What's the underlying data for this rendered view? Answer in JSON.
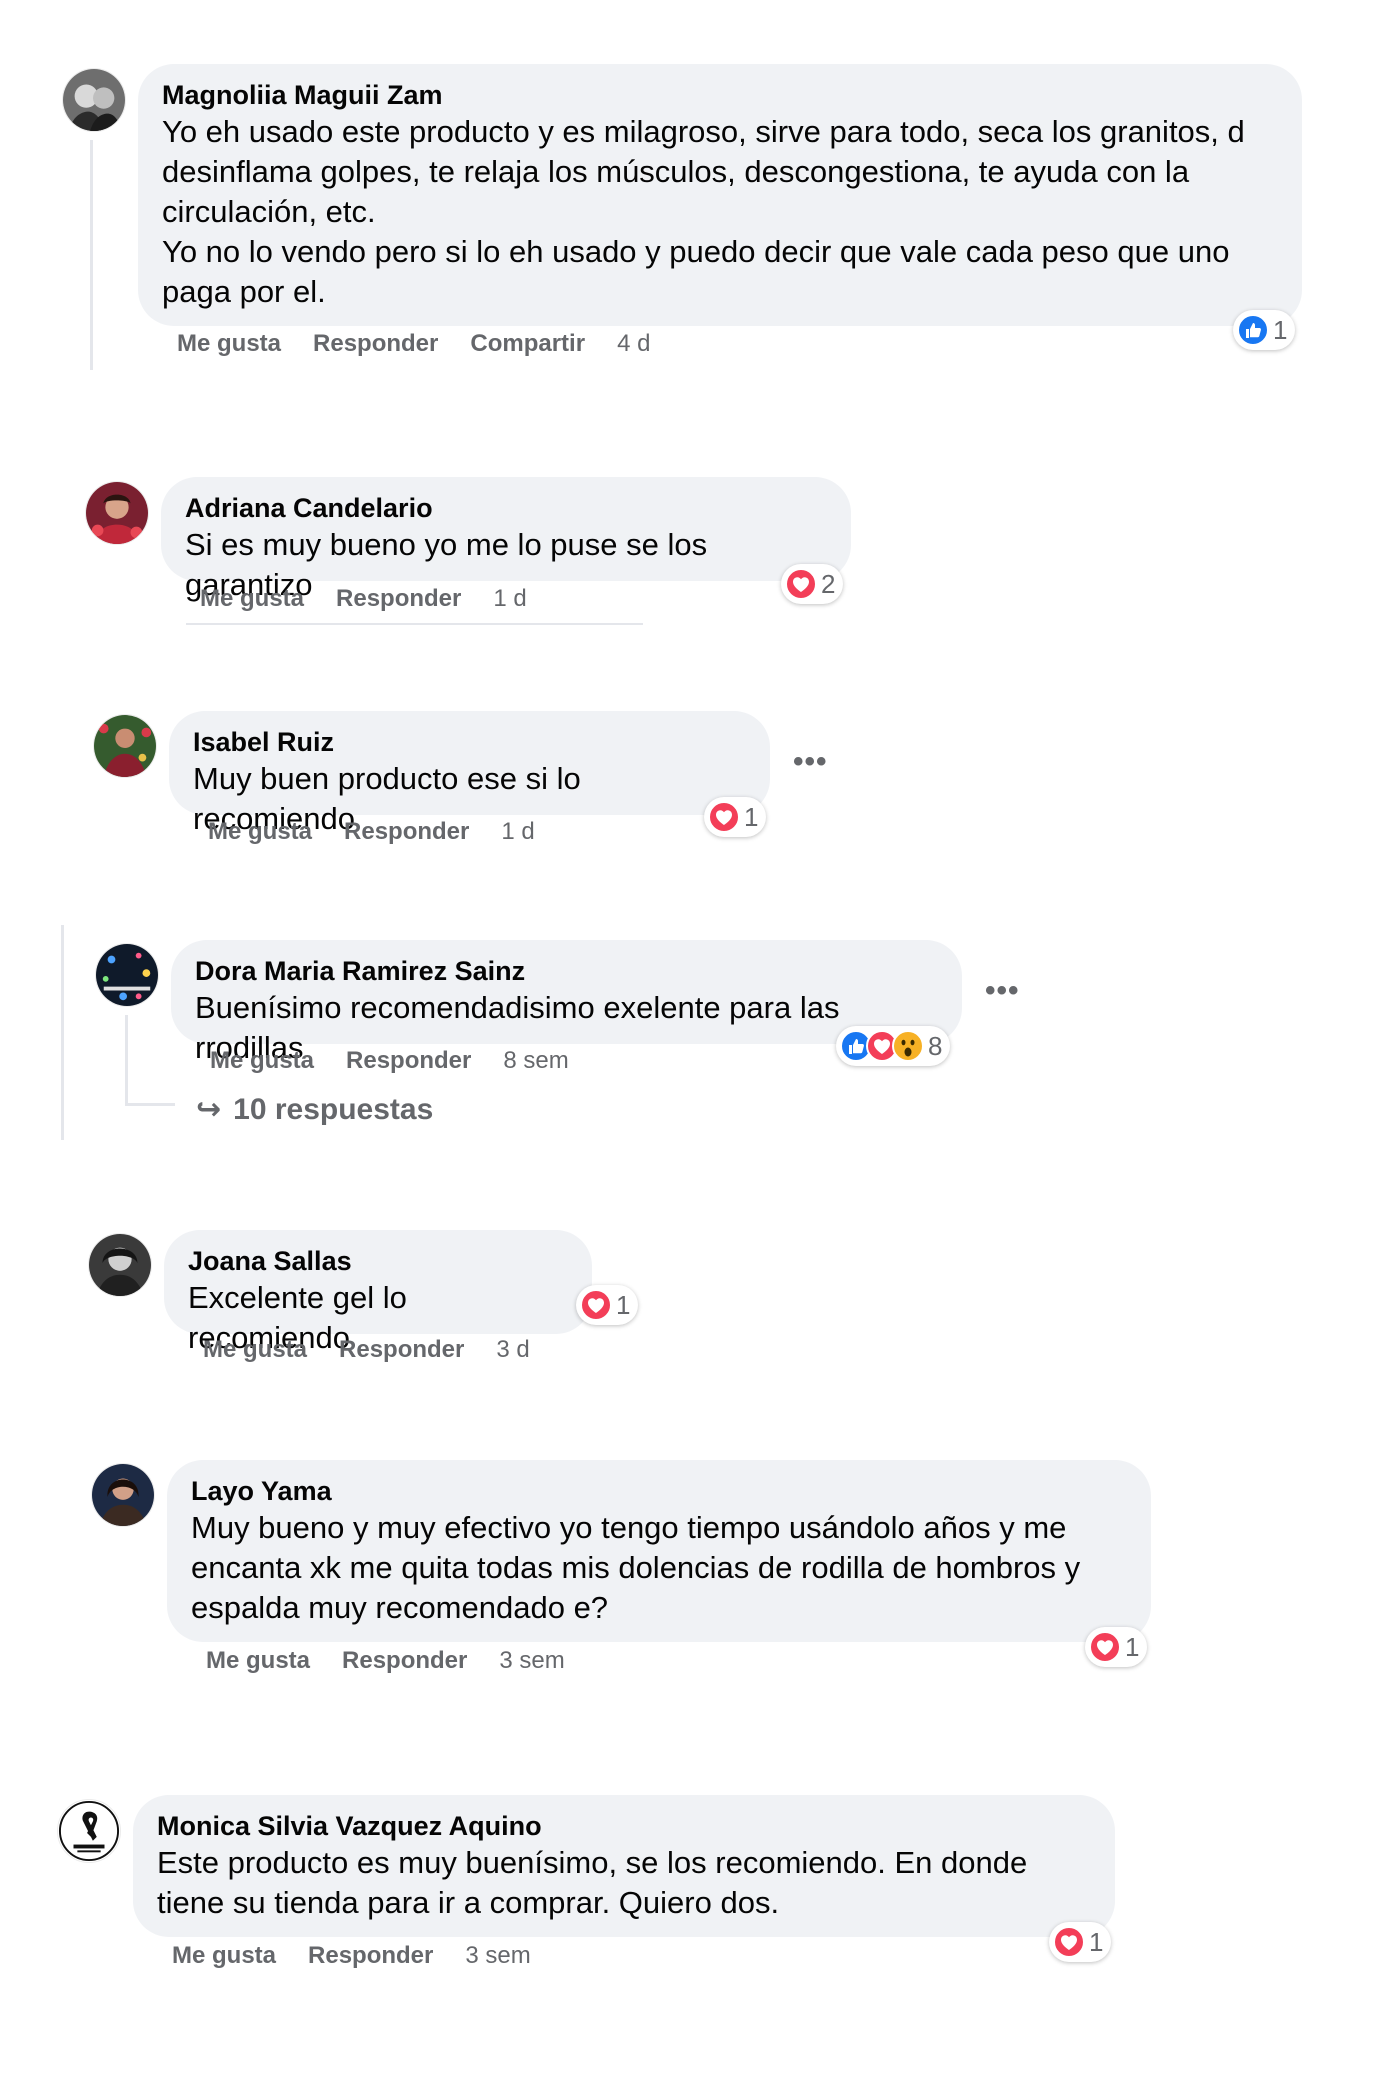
{
  "comments": [
    {
      "author": "Magnoliia Maguii Zam",
      "text": "Yo eh usado este producto y es milagroso, sirve para todo, seca los granitos, d desinflama golpes, te relaja los músculos, descongestiona, te ayuda con la circulación, etc.\nYo no lo vendo pero si lo eh usado y puedo decir que vale cada peso que uno paga por el.",
      "actions": {
        "like": "Me gusta",
        "reply": "Responder",
        "share": "Compartir",
        "time": "4 d"
      },
      "reactions": {
        "icons": [
          "like-icon"
        ],
        "count": "1"
      }
    },
    {
      "author": "Adriana Candelario",
      "text": "Si es muy bueno yo me lo puse se los garantizo",
      "actions": {
        "like": "Me gusta",
        "reply": "Responder",
        "time": "1 d"
      },
      "reactions": {
        "icons": [
          "love-icon"
        ],
        "count": "2"
      }
    },
    {
      "author": "Isabel Ruiz",
      "text": "Muy buen producto ese si lo recomiendo",
      "actions": {
        "like": "Me gusta",
        "reply": "Responder",
        "time": "1 d"
      },
      "reactions": {
        "icons": [
          "love-icon"
        ],
        "count": "1"
      }
    },
    {
      "author": "Dora Maria Ramirez Sainz",
      "text": "Buenísimo recomendadisimo exelente para las rrodillas",
      "actions": {
        "like": "Me gusta",
        "reply": "Responder",
        "time": "8 sem"
      },
      "reactions": {
        "icons": [
          "like-icon",
          "love-icon",
          "wow-icon"
        ],
        "count": "8"
      },
      "replies_label": "10 respuestas"
    },
    {
      "author": "Joana Sallas",
      "text": "Excelente gel lo recomiendo",
      "actions": {
        "like": "Me gusta",
        "reply": "Responder",
        "time": "3 d"
      },
      "reactions": {
        "icons": [
          "love-icon"
        ],
        "count": "1"
      }
    },
    {
      "author": "Layo Yama",
      "text": "Muy bueno y muy efectivo yo tengo tiempo usándolo años y me encanta xk me quita todas mis dolencias de rodilla de hombros y espalda muy recomendado e?",
      "actions": {
        "like": "Me gusta",
        "reply": "Responder",
        "time": "3 sem"
      },
      "reactions": {
        "icons": [
          "love-icon"
        ],
        "count": "1"
      }
    },
    {
      "author": "Monica Silvia Vazquez Aquino",
      "text": "Este producto es muy buenísimo, se los recomiendo. En donde tiene su tienda para ir a comprar. Quiero dos.",
      "actions": {
        "like": "Me gusta",
        "reply": "Responder",
        "time": "3 sem"
      },
      "reactions": {
        "icons": [
          "love-icon"
        ],
        "count": "1"
      }
    }
  ],
  "more_options": "•••",
  "colors": {
    "like": "#1877f2",
    "love": "#f33e58",
    "wow": "#f7b125",
    "bubble": "#f0f2f5",
    "meta": "#65676b"
  }
}
